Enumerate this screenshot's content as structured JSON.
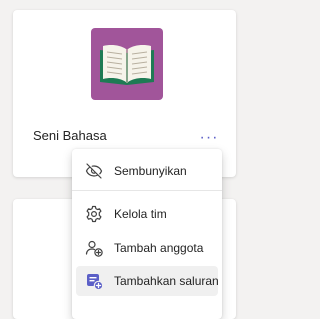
{
  "colors": {
    "tile_background": "#a1559a",
    "accent": "#5b5fc7",
    "book_green": "#1e7b54",
    "book_page": "#f6f3ea"
  },
  "team": {
    "name": "Seni Bahasa",
    "icon": "book-icon",
    "more_label": "···"
  },
  "menu": {
    "items": [
      {
        "label": "Sembunyikan",
        "icon": "eye-off-icon"
      },
      {
        "label": "Kelola tim",
        "icon": "gear-icon"
      },
      {
        "label": "Tambah anggota",
        "icon": "add-people-icon"
      },
      {
        "label": "Tambahkan saluran",
        "icon": "add-channel-icon"
      }
    ]
  }
}
